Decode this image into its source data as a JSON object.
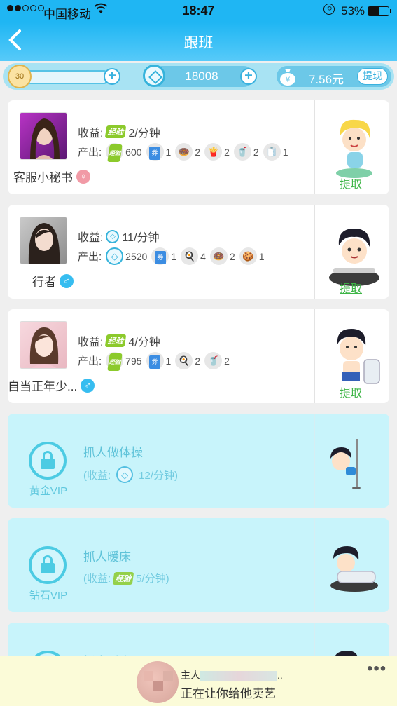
{
  "status_bar": {
    "carrier": "中国移动",
    "time": "18:47",
    "battery_pct": "53%",
    "battery_level": 0.53,
    "wifi_icon": "wifi-icon",
    "orientation_lock_icon": "orientation-lock-icon"
  },
  "nav": {
    "title": "跟班",
    "back_icon": "chevron-left-icon"
  },
  "resources": {
    "level": "30",
    "coins": "18008",
    "money": "7.56元",
    "withdraw_label": "提现"
  },
  "followers": [
    {
      "name": "客服小秘书",
      "gender": "female",
      "yield_label": "收益:",
      "yield_icon": "exp-tag",
      "yield_icon_text": "经验",
      "yield_value": "2/分钟",
      "output_label": "产出:",
      "outputs": [
        {
          "icon": "exp-tag",
          "text": "经验",
          "count": "600"
        },
        {
          "icon": "ticket-icon",
          "text": "券",
          "count": "1"
        },
        {
          "icon": "donut-icon",
          "text": "🍩",
          "count": "2"
        },
        {
          "icon": "fries-icon",
          "text": "🍟",
          "count": "2"
        },
        {
          "icon": "drink-icon",
          "text": "🥤",
          "count": "2"
        },
        {
          "icon": "towel-icon",
          "text": "🧻",
          "count": "1"
        }
      ],
      "claim_label": "提取"
    },
    {
      "name": "行者",
      "gender": "male",
      "yield_label": "收益:",
      "yield_icon": "coin-icon",
      "yield_icon_text": "",
      "yield_value": "11/分钟",
      "output_label": "产出:",
      "outputs": [
        {
          "icon": "coin-icon",
          "text": "◇",
          "count": "2520"
        },
        {
          "icon": "ticket-icon",
          "text": "券",
          "count": "1"
        },
        {
          "icon": "egg-icon",
          "text": "🍳",
          "count": "4"
        },
        {
          "icon": "donut-icon",
          "text": "🍩",
          "count": "2"
        },
        {
          "icon": "cookie-icon",
          "text": "🍪",
          "count": "1"
        }
      ],
      "claim_label": "提取"
    },
    {
      "name": "自当正年少...",
      "gender": "male",
      "yield_label": "收益:",
      "yield_icon": "exp-tag",
      "yield_icon_text": "经验",
      "yield_value": "4/分钟",
      "output_label": "产出:",
      "outputs": [
        {
          "icon": "exp-tag",
          "text": "经验",
          "count": "795"
        },
        {
          "icon": "ticket-icon",
          "text": "券",
          "count": "1"
        },
        {
          "icon": "egg-icon",
          "text": "🍳",
          "count": "2"
        },
        {
          "icon": "drink-icon",
          "text": "🥤",
          "count": "2"
        }
      ],
      "claim_label": "提取"
    }
  ],
  "locked_slots": [
    {
      "vip": "黄金VIP",
      "title": "抓人做体操",
      "yield_prefix": "(收益:",
      "yield_icon": "coin-icon",
      "yield_icon_text": "",
      "yield_value": "12/分钟)"
    },
    {
      "vip": "钻石VIP",
      "title": "抓人暖床",
      "yield_prefix": "(收益:",
      "yield_icon": "exp-tag",
      "yield_icon_text": "经验",
      "yield_value": "5/分钟)"
    },
    {
      "vip": "",
      "title": "抓人暖床",
      "yield_prefix": "",
      "yield_icon": "",
      "yield_icon_text": "",
      "yield_value": ""
    }
  ],
  "notice": {
    "line1_prefix": "主人",
    "line1_suffix": "..",
    "line2": "正在让你给他卖艺",
    "more_icon": "more-dots-icon",
    "more_text": "•••"
  },
  "colors": {
    "header_blue": "#1fb6f3",
    "claim_green": "#3db546",
    "locked_bg": "#c8f4fb"
  }
}
